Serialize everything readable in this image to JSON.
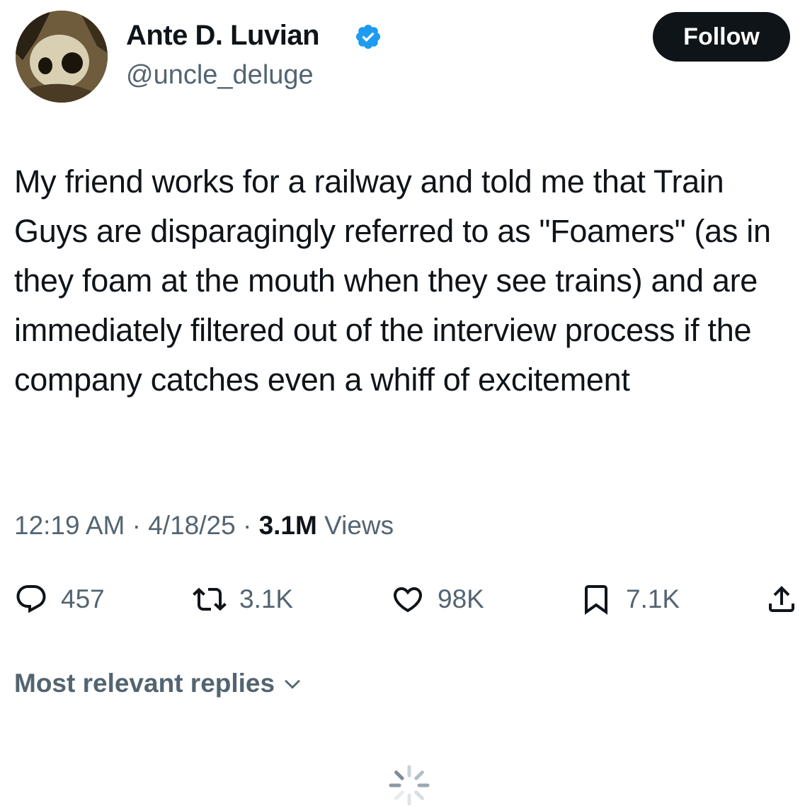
{
  "author": {
    "display_name": "Ante D. Luvian",
    "handle": "@uncle_deluge",
    "verified": true,
    "avatar_icon": "masked-figure-avatar"
  },
  "follow_button": {
    "label": "Follow"
  },
  "tweet": {
    "text": "My friend works for a railway and told me that Train Guys are disparagingly referred to as \"Foamers\" (as in they foam at the mouth when they see trains) and are immediately filtered out of the interview process if the company catches even a whiff of excitement",
    "time": "12:19 AM",
    "separator": "·",
    "date": "4/18/25",
    "views_count": "3.1M",
    "views_label": "Views"
  },
  "actions": {
    "replies": {
      "icon": "reply-icon",
      "count": "457"
    },
    "reposts": {
      "icon": "repost-icon",
      "count": "3.1K"
    },
    "likes": {
      "icon": "heart-icon",
      "count": "98K"
    },
    "bookmarks": {
      "icon": "bookmark-icon",
      "count": "7.1K"
    },
    "share": {
      "icon": "share-icon"
    }
  },
  "replies_sort": {
    "label": "Most relevant replies",
    "icon": "chevron-down-icon"
  },
  "colors": {
    "text_primary": "#0f1419",
    "text_secondary": "#536471",
    "verified_blue": "#1d9bf0",
    "button_bg": "#0f1419",
    "background": "#ffffff"
  }
}
